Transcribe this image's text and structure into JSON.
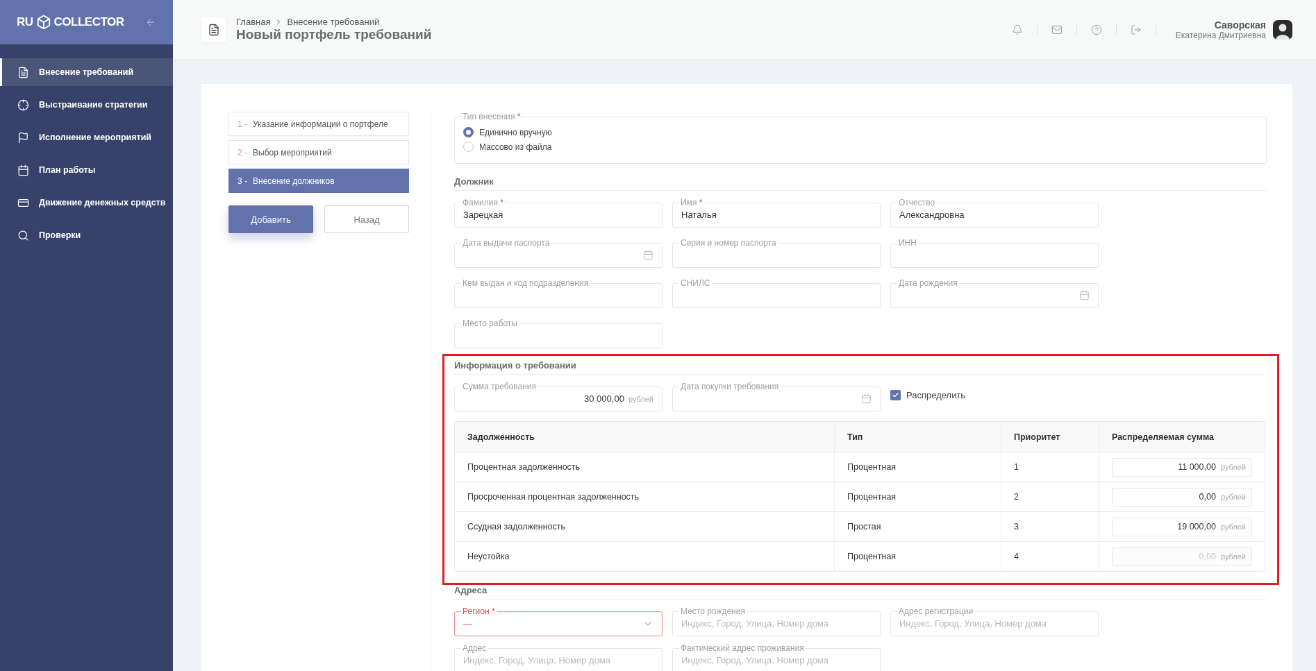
{
  "sidebar": {
    "logo_left": "RU",
    "logo_right": "COLLECTOR",
    "items": [
      {
        "label": "Внесение требований",
        "selected": true
      },
      {
        "label": "Выстраивание стратегии",
        "selected": false
      },
      {
        "label": "Исполнение мероприятий",
        "selected": false
      },
      {
        "label": "План работы",
        "selected": false
      },
      {
        "label": "Движение денежных средств",
        "selected": false
      },
      {
        "label": "Проверки",
        "selected": false
      }
    ]
  },
  "header": {
    "breadcrumbs": [
      "Главная",
      "Внесение требований"
    ],
    "title": "Новый портфель требований",
    "user_name": "Саворская",
    "user_subtitle": "Екатерина Дмитриевна"
  },
  "steps": [
    {
      "number": "1 -",
      "label": "Указание информации о портфеле",
      "selected": false
    },
    {
      "number": "2 -",
      "label": "Выбор мероприятий",
      "selected": false
    },
    {
      "number": "3 -",
      "label": "Внесение должников",
      "selected": true
    }
  ],
  "buttons": [
    {
      "label": "Добавить",
      "kind": "primary"
    },
    {
      "label": "Назад",
      "kind": "secondary"
    }
  ],
  "entry_type": {
    "label": "Тип внесения",
    "required_mark": "*",
    "options": [
      {
        "label": "Единично вручную",
        "selected": true
      },
      {
        "label": "Массово из файла",
        "selected": false
      }
    ]
  },
  "debtor": {
    "title": "Должник",
    "fields": [
      {
        "kind": "text",
        "label": "Фамилия",
        "required_mark": "*",
        "value": "Зарецкая"
      },
      {
        "kind": "text",
        "label": "Имя",
        "required_mark": "*",
        "value": "Наталья"
      },
      {
        "kind": "text",
        "label": "Отчество",
        "value": "Александровна"
      },
      {
        "kind": "date",
        "label": "Дата выдачи паспорта"
      },
      {
        "kind": "text",
        "label": "Серия и номер паспорта"
      },
      {
        "kind": "text",
        "label": "ИНН"
      },
      {
        "kind": "text",
        "label": "Кем выдан и код подразделения"
      },
      {
        "kind": "text",
        "label": "СНИЛС"
      },
      {
        "kind": "date",
        "label": "Дата рождения"
      },
      {
        "kind": "text",
        "label": "Место работы"
      }
    ]
  },
  "claim": {
    "title": "Информация о требовании",
    "highlighted": true,
    "fields": [
      {
        "kind": "money",
        "label": "Сумма требования",
        "value": "30 000,00",
        "unit": "рублей"
      },
      {
        "kind": "date",
        "label": "Дата покупки требования"
      }
    ],
    "distribute": {
      "label": "Распределить",
      "checked": true
    },
    "table": {
      "columns": [
        "Задолженность",
        "Тип",
        "Приоритет",
        "Распределяемая сумма"
      ],
      "rows": [
        {
          "debt": "Процентная задолженность",
          "type": "Процентная",
          "priority": "1",
          "amount": "11 000,00",
          "unit": "рублей",
          "disabled": false
        },
        {
          "debt": "Просроченная процентная задолженность",
          "type": "Процентная",
          "priority": "2",
          "amount": "0,00",
          "unit": "рублей",
          "disabled": false
        },
        {
          "debt": "Ссудная задолженность",
          "type": "Простая",
          "priority": "3",
          "amount": "19 000,00",
          "unit": "рублей",
          "disabled": false
        },
        {
          "debt": "Неустойка",
          "type": "Процентная",
          "priority": "4",
          "amount": "0,00",
          "unit": "рублей",
          "disabled": true
        }
      ]
    }
  },
  "addresses": {
    "title": "Адреса",
    "fields": [
      {
        "kind": "select",
        "label": "Регион",
        "required_mark": "*",
        "value": "—",
        "error": true
      },
      {
        "kind": "text",
        "label": "Место рождения",
        "placeholder": "Индекс, Город, Улица, Номер дома"
      },
      {
        "kind": "text",
        "label": "Адрес регистрации",
        "placeholder": "Индекс, Город, Улица, Номер дома"
      },
      {
        "kind": "text",
        "label": "Адрес",
        "placeholder": "Индекс, Город, Улица, Номер дома"
      },
      {
        "kind": "text",
        "label": "Фактический адрес проживания",
        "placeholder": "Индекс, Город, Улица, Номер дома"
      }
    ]
  }
}
